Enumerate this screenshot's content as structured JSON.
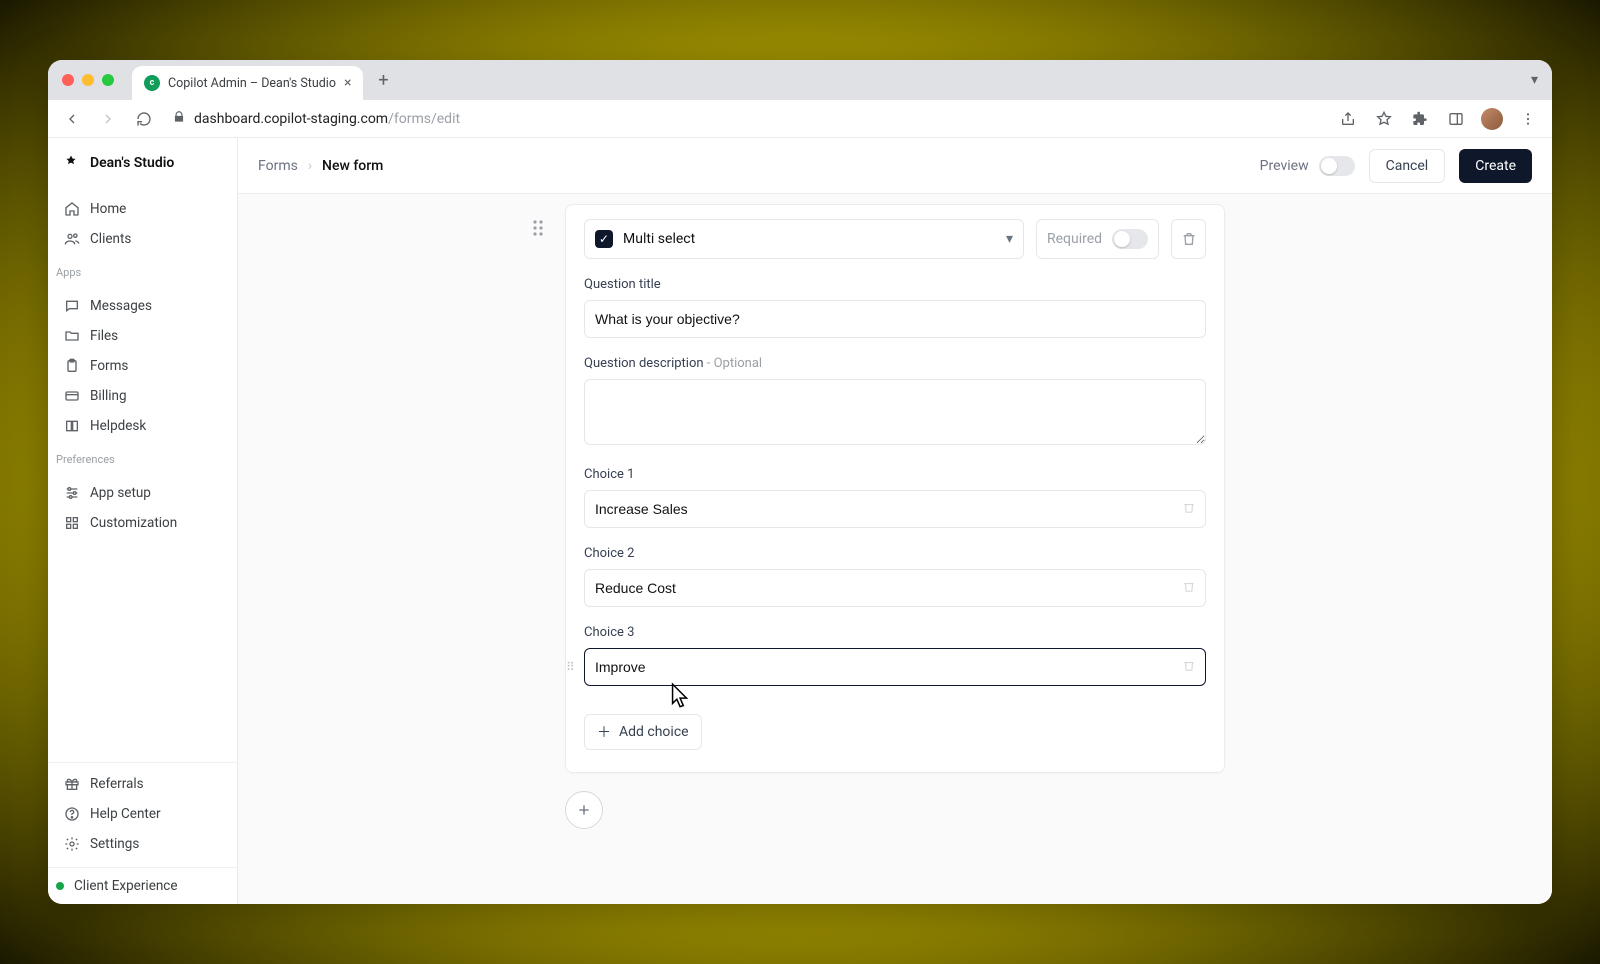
{
  "browser": {
    "tab_title": "Copilot Admin – Dean's Studio",
    "url_host": "dashboard.copilot-staging.com",
    "url_path": "/forms/edit"
  },
  "sidebar": {
    "brand": "Dean's Studio",
    "nav_top": [
      {
        "label": "Home",
        "icon": "home-icon"
      },
      {
        "label": "Clients",
        "icon": "users-icon"
      }
    ],
    "group_apps_label": "Apps",
    "nav_apps": [
      {
        "label": "Messages",
        "icon": "chat-icon"
      },
      {
        "label": "Files",
        "icon": "folder-icon"
      },
      {
        "label": "Forms",
        "icon": "clipboard-icon"
      },
      {
        "label": "Billing",
        "icon": "card-icon"
      },
      {
        "label": "Helpdesk",
        "icon": "book-icon"
      }
    ],
    "group_prefs_label": "Preferences",
    "nav_prefs": [
      {
        "label": "App setup",
        "icon": "sliders-icon"
      },
      {
        "label": "Customization",
        "icon": "grid-icon"
      }
    ],
    "nav_bottom": [
      {
        "label": "Referrals",
        "icon": "gift-icon"
      },
      {
        "label": "Help Center",
        "icon": "help-icon"
      },
      {
        "label": "Settings",
        "icon": "gear-icon"
      }
    ],
    "client_experience_label": "Client Experience"
  },
  "header": {
    "breadcrumb_root": "Forms",
    "breadcrumb_current": "New form",
    "preview_label": "Preview",
    "cancel_label": "Cancel",
    "create_label": "Create"
  },
  "editor": {
    "question_type_label": "Multi select",
    "required_label": "Required",
    "title_label": "Question title",
    "title_value": "What is your objective?",
    "desc_label": "Question description",
    "desc_optional": " - Optional",
    "desc_value": "",
    "choices": [
      {
        "label": "Choice 1",
        "value": "Increase Sales"
      },
      {
        "label": "Choice 2",
        "value": "Reduce Cost"
      },
      {
        "label": "Choice 3",
        "value": "Improve"
      }
    ],
    "add_choice_label": "Add choice"
  }
}
